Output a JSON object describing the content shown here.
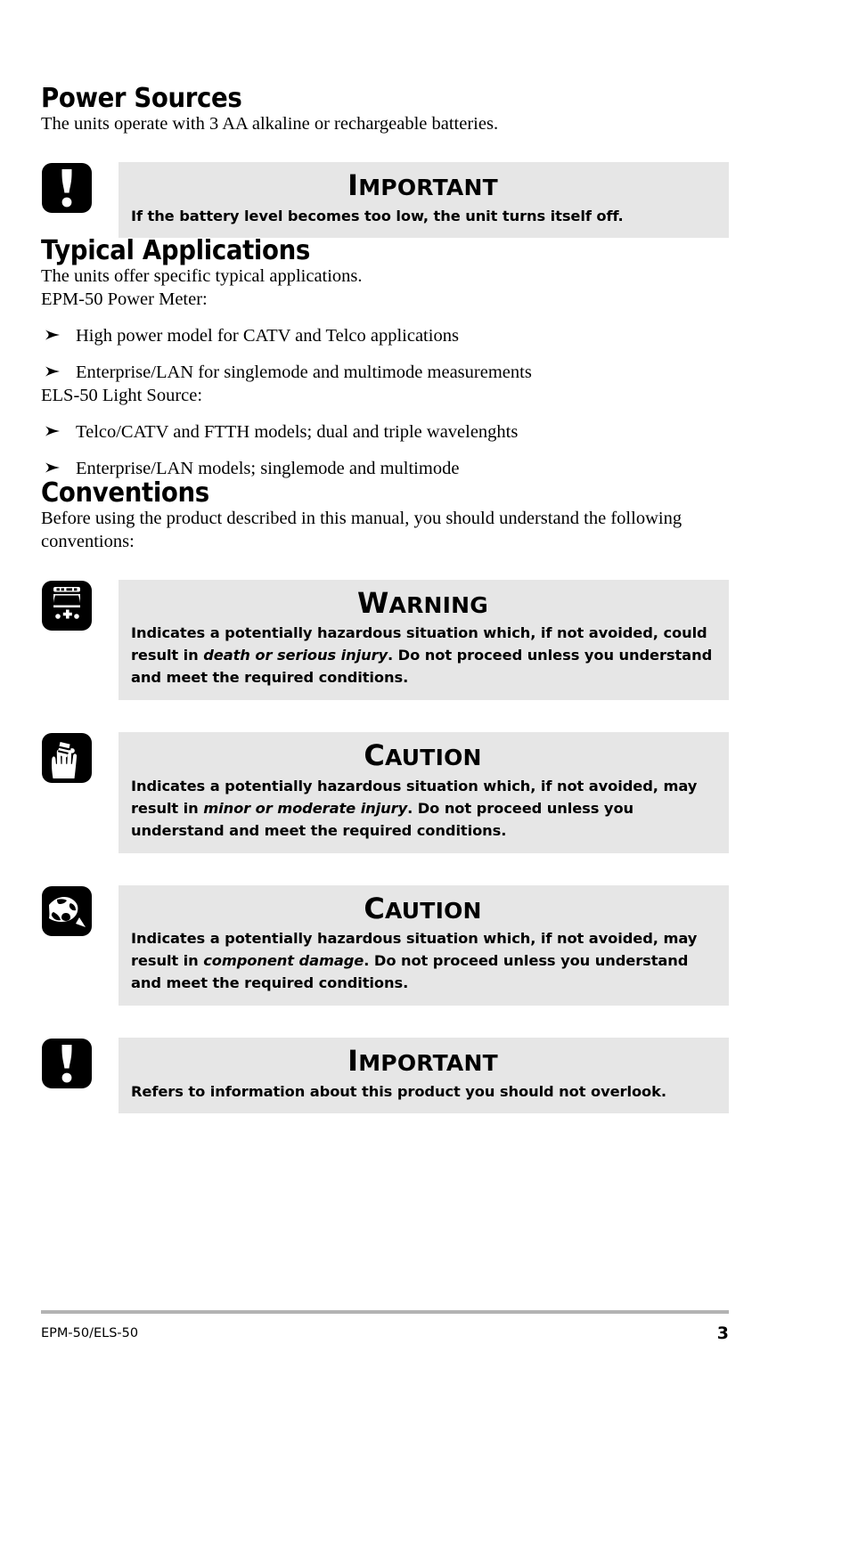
{
  "document": {
    "footer": {
      "left_label": "EPM-50/ELS-50",
      "page_number": "3"
    }
  },
  "sections": {
    "power_sources": {
      "heading": "Power Sources",
      "intro": "The units operate with 3 AA alkaline or rechargeable batteries.",
      "important": {
        "icon": "important-exclamation-icon",
        "title_first": "I",
        "title_rest": "MPORTANT",
        "text": "If the battery level becomes too low, the unit turns itself off."
      }
    },
    "typical_applications": {
      "heading": "Typical Applications",
      "intro": "The units offer specific typical applications.",
      "group1_label": "EPM-50 Power Meter:",
      "group1_items": [
        "High power model for CATV and Telco applications",
        "Enterprise/LAN for singlemode and multimode measurements"
      ],
      "group2_label": "ELS-50 Light Source:",
      "group2_items": [
        "Telco/CATV and FTTH models; dual and triple wavelenghts",
        "Enterprise/LAN models; singlemode and multimode"
      ]
    },
    "conventions": {
      "heading": "Conventions",
      "intro": "Before using the product described in this manual, you should understand the following conventions:",
      "alerts": [
        {
          "icon": "ambulance-icon",
          "title_first": "W",
          "title_rest": "ARNING",
          "text_part1": "Indicates a potentially hazardous situation which, if not avoided, could result in ",
          "text_emphasis": "death or serious injury",
          "text_part2": ". Do not proceed unless you understand and meet the required conditions."
        },
        {
          "icon": "bandaged-hand-icon",
          "title_first": "C",
          "title_rest": "AUTION",
          "text_part1": "Indicates a potentially hazardous situation which, if not avoided, may result in ",
          "text_emphasis": "minor or moderate injury",
          "text_part2": ". Do not proceed unless you understand and meet the required conditions."
        },
        {
          "icon": "broken-component-icon",
          "title_first": "C",
          "title_rest": "AUTION",
          "text_part1": "Indicates a potentially hazardous situation which, if not avoided, may result in ",
          "text_emphasis": "component damage",
          "text_part2": ". Do not proceed unless you understand and meet the required conditions."
        },
        {
          "icon": "important-exclamation-icon",
          "title_first": "I",
          "title_rest": "MPORTANT",
          "text_part1": "Refers to information about this product you should not overlook.",
          "text_emphasis": "",
          "text_part2": ""
        }
      ]
    }
  },
  "colors": {
    "alert_background": "#e6e6e6",
    "icon_fill": "#000000",
    "footer_rule": "#b3b3b3",
    "page_background": "#ffffff"
  }
}
